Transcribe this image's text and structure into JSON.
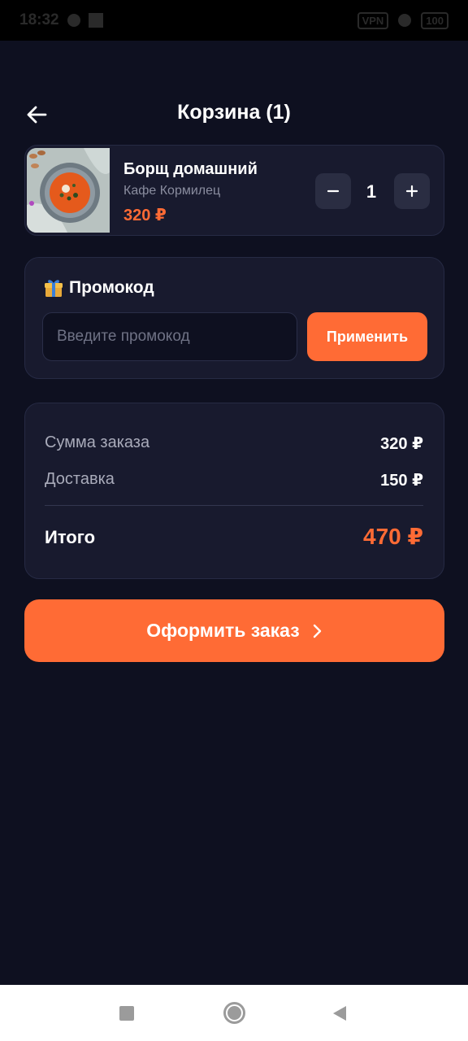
{
  "status_bar": {
    "time": "18:32",
    "battery": "100",
    "network_badge": "VPN"
  },
  "header": {
    "title": "Корзина (1)"
  },
  "cart": {
    "items": [
      {
        "name": "Борщ домашний",
        "cafe": "Кафе Кормилец",
        "price": "320 ₽",
        "quantity": "1",
        "minus_label": "−",
        "plus_label": "+"
      }
    ]
  },
  "promo": {
    "emoji": "🎁",
    "title": "Промокод",
    "placeholder": "Введите промокод",
    "value": "",
    "apply_label": "Применить"
  },
  "summary": {
    "subtotal_label": "Сумма заказа",
    "subtotal_value": "320 ₽",
    "delivery_label": "Доставка",
    "delivery_value": "150 ₽",
    "total_label": "Итого",
    "total_value": "470 ₽"
  },
  "checkout": {
    "label": "Оформить заказ",
    "chevron": "›"
  },
  "colors": {
    "background": "#0e1020",
    "card": "#181a2e",
    "accent": "#ff6b35",
    "muted_text": "#a9abba"
  },
  "icons": {
    "back": "arrow-left-icon",
    "gift": "gift-icon",
    "chevron": "chevron-right-icon",
    "nav_recents": "square-icon",
    "nav_home": "circle-icon",
    "nav_back": "triangle-back-icon"
  }
}
